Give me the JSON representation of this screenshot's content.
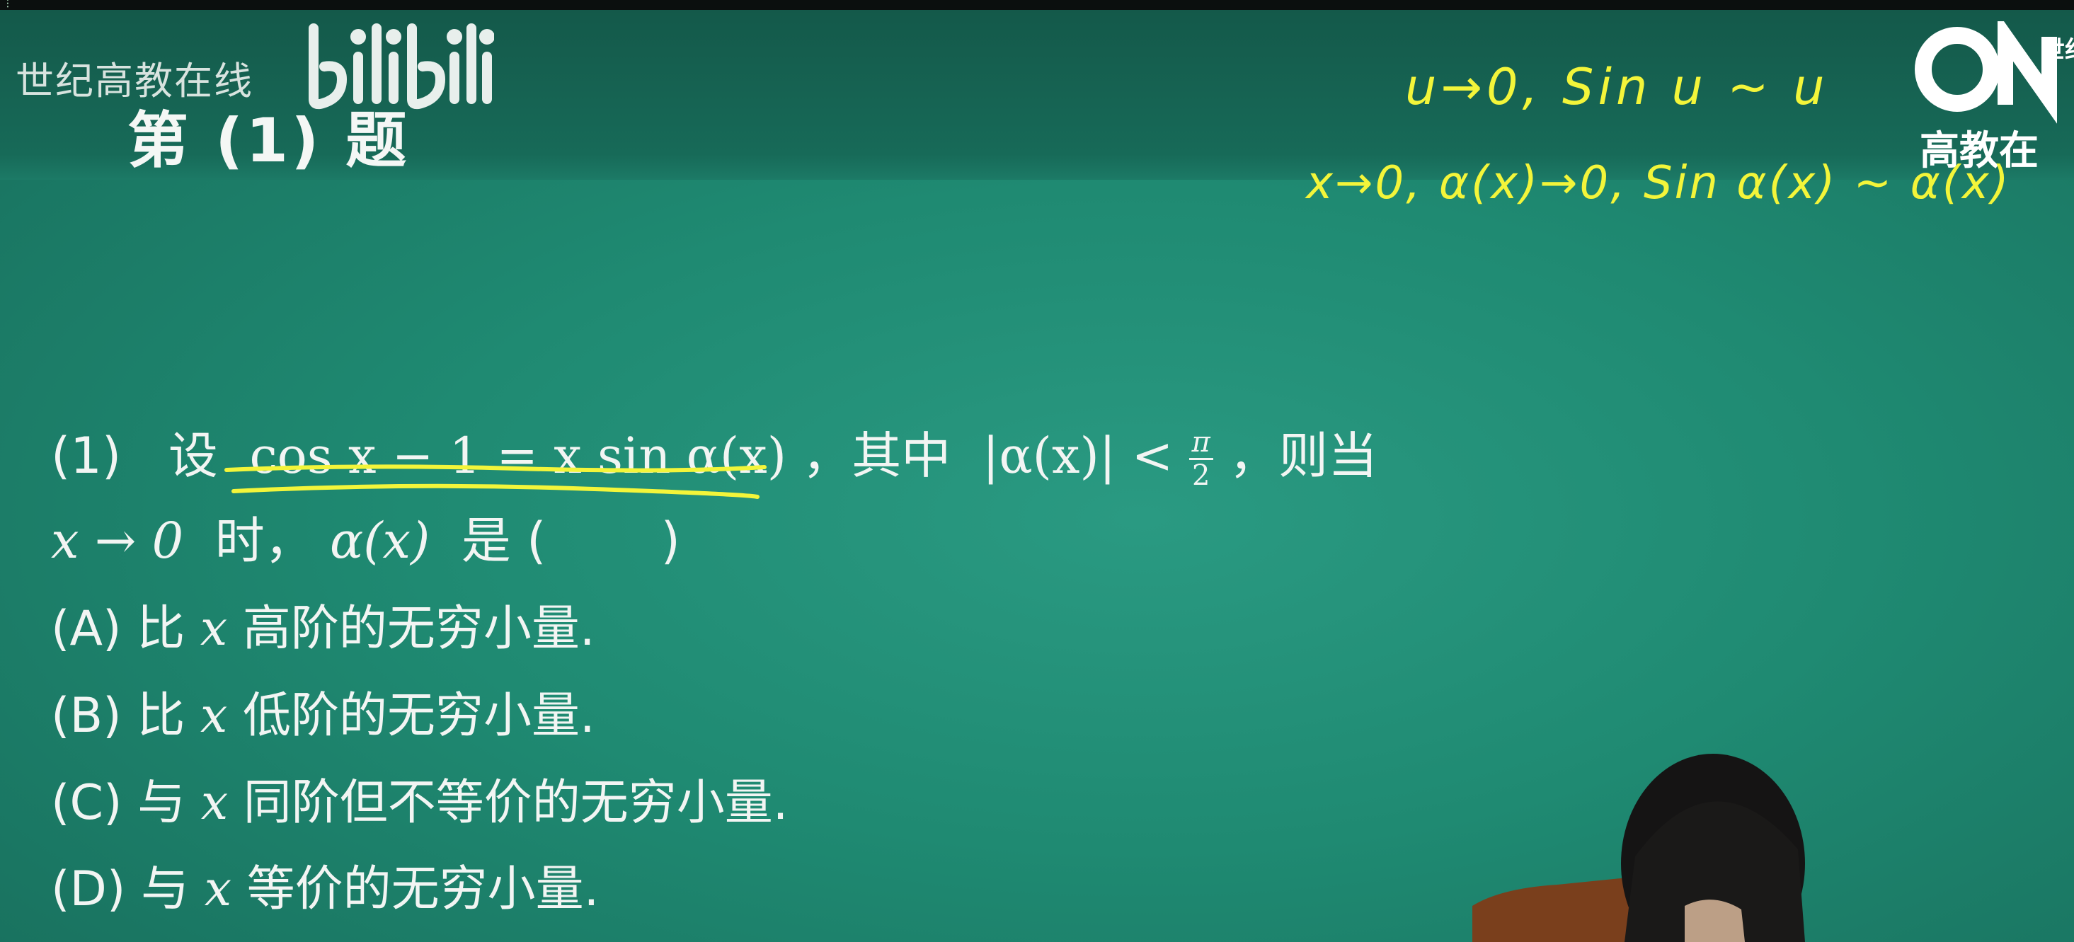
{
  "overlay": {
    "channel": "世纪高教在线",
    "platform_logo_text": "bilibili",
    "brand_logo_text": "ON",
    "brand_logo_side": "世纪",
    "brand_sub": "高教在"
  },
  "slide": {
    "section_title": "第 (1) 题",
    "handwriting": {
      "line1": "u→0,  Sin u ~ u",
      "line2": "x→0,  α(x)→0,  Sin α(x) ~ α(x)"
    },
    "question": {
      "number": "(1)",
      "lead": "设",
      "formula": "cos x − 1 = x sin α(x)",
      "mid": "，其中",
      "condition": "|α(x)| <",
      "frac_num": "π",
      "frac_den": "2",
      "tail": "，则当",
      "line2_math": "x → 0",
      "line2_text": "时，",
      "line2_alpha": "α(x)",
      "line2_end": "是 (　　 )"
    },
    "options": [
      {
        "label": "(A)",
        "pre": "比",
        "var": "x",
        "text": "高阶的无穷小量."
      },
      {
        "label": "(B)",
        "pre": "比",
        "var": "x",
        "text": "低阶的无穷小量."
      },
      {
        "label": "(C)",
        "pre": "与",
        "var": "x",
        "text": "同阶但不等价的无穷小量."
      },
      {
        "label": "(D)",
        "pre": "与",
        "var": "x",
        "text": "等价的无穷小量."
      }
    ]
  },
  "colors": {
    "board": "#1f8a72",
    "header": "#14594a",
    "handwriting": "#f3f53a",
    "text": "#f2f5f3"
  }
}
